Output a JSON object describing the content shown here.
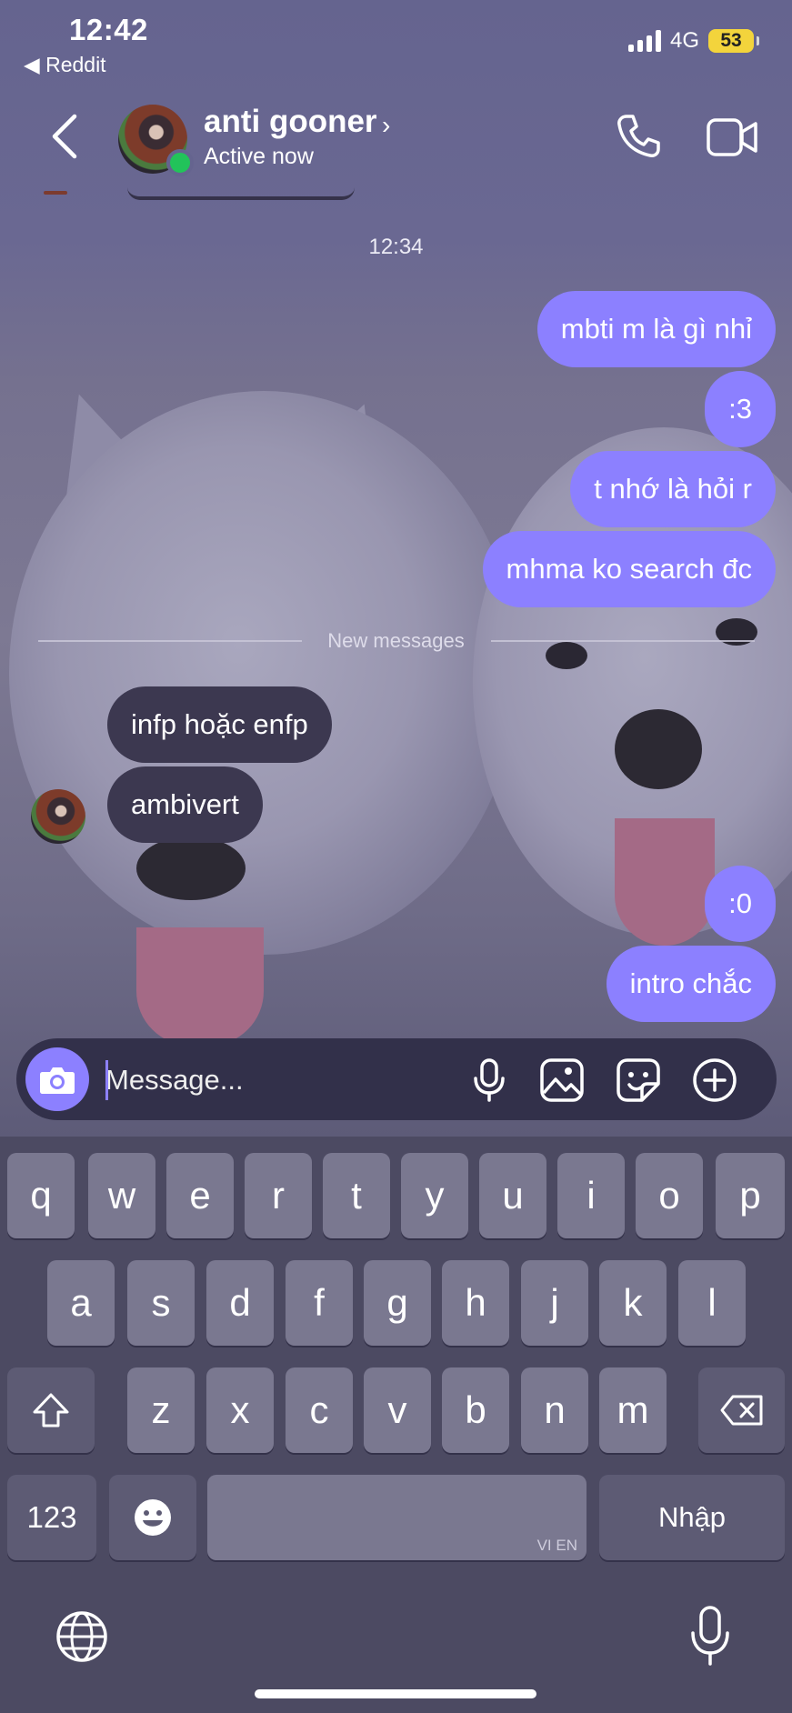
{
  "status_bar": {
    "time": "12:42",
    "back_app": "◀ Reddit",
    "network": "4G",
    "battery": "53"
  },
  "header": {
    "name": "anti gooner",
    "status": "Active now",
    "back_icon": "chevron-left-icon",
    "call_icon": "phone-icon",
    "video_icon": "video-camera-icon"
  },
  "chat": {
    "timestamp": "12:34",
    "outgoing_1": [
      "mbti m là gì nhỉ",
      ":3",
      "t nhớ là hỏi r",
      "mhma ko search đc"
    ],
    "new_messages_label": "New messages",
    "incoming": [
      "infp hoặc enfp",
      "ambivert"
    ],
    "outgoing_2": [
      ":0",
      "intro chắc"
    ]
  },
  "composer": {
    "placeholder": "Message...",
    "icons": [
      "camera-icon",
      "microphone-icon",
      "gallery-icon",
      "sticker-icon",
      "plus-icon"
    ]
  },
  "keyboard": {
    "row1": [
      "q",
      "w",
      "e",
      "r",
      "t",
      "y",
      "u",
      "i",
      "o",
      "p"
    ],
    "row2": [
      "a",
      "s",
      "d",
      "f",
      "g",
      "h",
      "j",
      "k",
      "l"
    ],
    "row3": [
      "z",
      "x",
      "c",
      "v",
      "b",
      "n",
      "m"
    ],
    "numbers_key": "123",
    "return_key": "Nhập",
    "space_hint": "VI EN",
    "icons": [
      "shift-icon",
      "backspace-icon",
      "emoji-icon",
      "globe-icon",
      "dictation-icon"
    ]
  },
  "colors": {
    "accent": "#8c80ff",
    "incoming_bubble": "#3c3850",
    "online": "#22c35a"
  }
}
